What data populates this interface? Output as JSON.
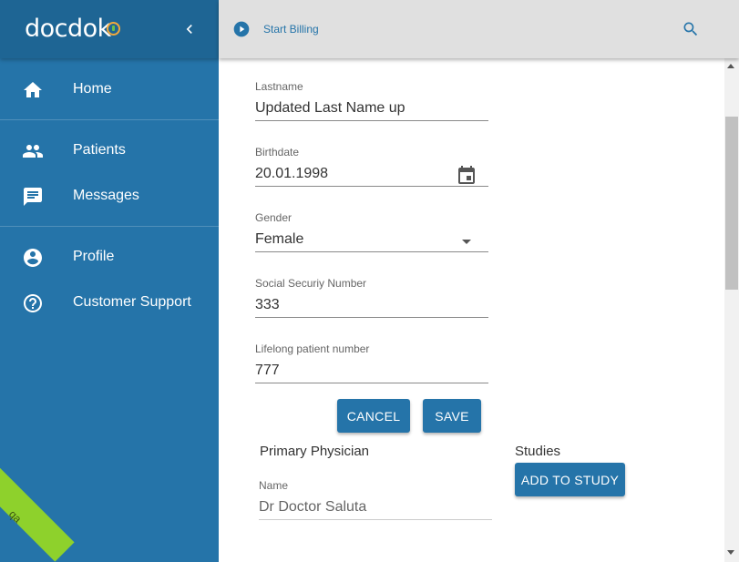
{
  "app": {
    "logo_text": "docdok"
  },
  "sidebar": {
    "items": [
      {
        "label": "Home",
        "icon": "home-icon"
      },
      {
        "label": "Patients",
        "icon": "people-icon"
      },
      {
        "label": "Messages",
        "icon": "message-icon"
      },
      {
        "label": "Profile",
        "icon": "account-circle-icon"
      },
      {
        "label": "Customer Support",
        "icon": "help-circle-icon"
      }
    ],
    "env_badge": "qa"
  },
  "topbar": {
    "billing_label": "Start Billing"
  },
  "form": {
    "lastname": {
      "label": "Lastname",
      "value": "Updated Last Name up"
    },
    "birthdate": {
      "label": "Birthdate",
      "value": "20.01.1998"
    },
    "gender": {
      "label": "Gender",
      "value": "Female"
    },
    "ssn": {
      "label": "Social Securiy Number",
      "value": "333"
    },
    "patient_number": {
      "label": "Lifelong patient number",
      "value": "777"
    },
    "cancel_label": "Cancel",
    "save_label": "Save"
  },
  "physician": {
    "title": "Primary Physician",
    "name_label": "Name",
    "name_value": "Dr Doctor Saluta"
  },
  "studies": {
    "title": "Studies",
    "add_label": "Add to study"
  },
  "colors": {
    "sidebar": "#2574a9",
    "sidebar_header": "#1e6594",
    "accent": "#2574a9",
    "topbar": "#e0e0e0",
    "qa_badge": "#8ed12c"
  }
}
